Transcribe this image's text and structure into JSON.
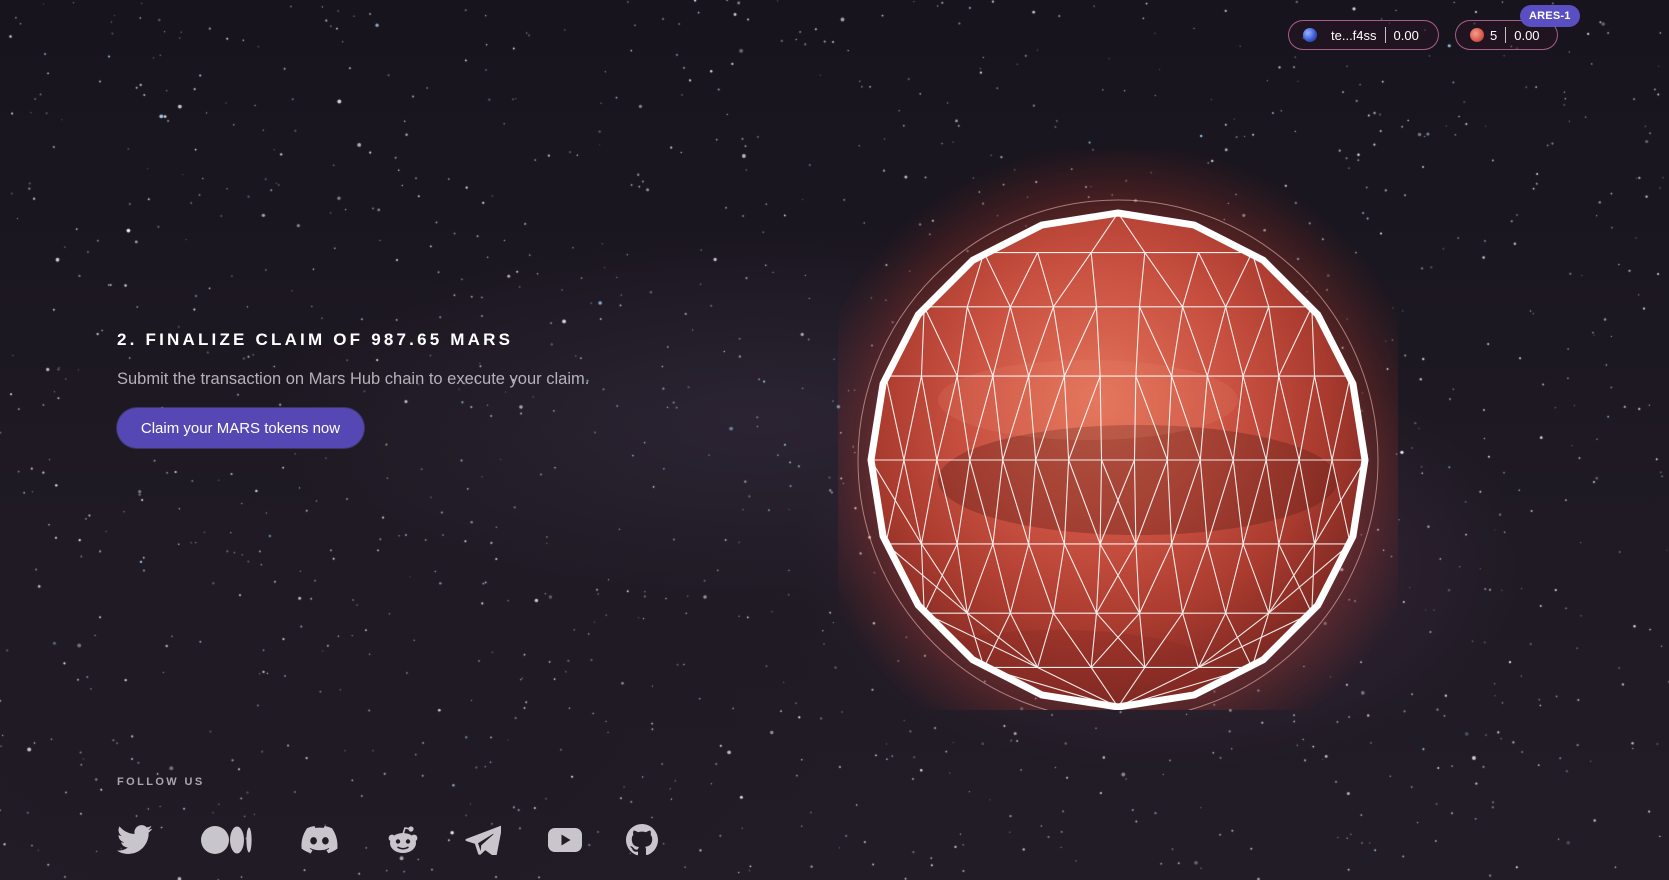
{
  "header": {
    "wallet": {
      "icon": "terra-globe-icon",
      "address": "te...f4ss",
      "balance": "0.00"
    },
    "mars": {
      "icon": "mars-token-icon",
      "count": "5",
      "balance": "0.00",
      "chain_badge": "ARES-1"
    }
  },
  "main": {
    "title": "2. FINALIZE CLAIM OF 987.65 MARS",
    "description": "Submit the transaction on Mars Hub chain to execute your claim.",
    "button_label": "Claim your MARS tokens now",
    "planet": "mars-geodesic-sphere"
  },
  "footer": {
    "follow_label": "FOLLOW US",
    "socials": [
      {
        "name": "twitter-icon"
      },
      {
        "name": "medium-icon"
      },
      {
        "name": "discord-icon"
      },
      {
        "name": "reddit-icon"
      },
      {
        "name": "telegram-icon"
      },
      {
        "name": "youtube-icon"
      },
      {
        "name": "github-icon"
      }
    ]
  },
  "colors": {
    "accent": "#5548b4",
    "badge": "#5a4fc2",
    "pill_border": "#d278aa",
    "mars_red": "#c8503a",
    "social_icon": "#c9c5cc"
  }
}
